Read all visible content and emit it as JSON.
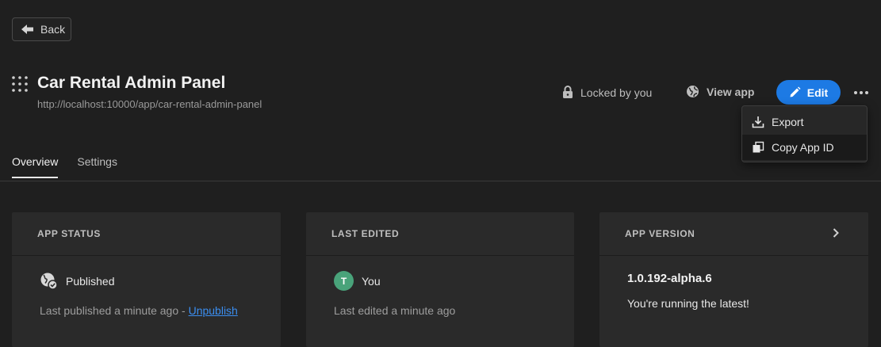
{
  "header": {
    "back_label": "Back",
    "app_title": "Car Rental Admin Panel",
    "app_url": "http://localhost:10000/app/car-rental-admin-panel",
    "locked_label": "Locked by you",
    "view_app_label": "View app",
    "edit_label": "Edit",
    "accent_color": "#1d7ae4"
  },
  "menu": {
    "items": [
      {
        "label": "Export",
        "icon": "download-icon"
      },
      {
        "label": "Copy App ID",
        "icon": "copy-icon"
      }
    ]
  },
  "tabs": [
    {
      "label": "Overview",
      "active": true
    },
    {
      "label": "Settings",
      "active": false
    }
  ],
  "cards": {
    "status": {
      "heading": "APP STATUS",
      "value": "Published",
      "note_prefix": "Last published a minute ago - ",
      "link_label": "Unpublish"
    },
    "edited": {
      "heading": "LAST EDITED",
      "avatar_initial": "T",
      "user": "You",
      "note": "Last edited a minute ago"
    },
    "version": {
      "heading": "APP VERSION",
      "value": "1.0.192-alpha.6",
      "note": "You're running the latest!"
    }
  }
}
